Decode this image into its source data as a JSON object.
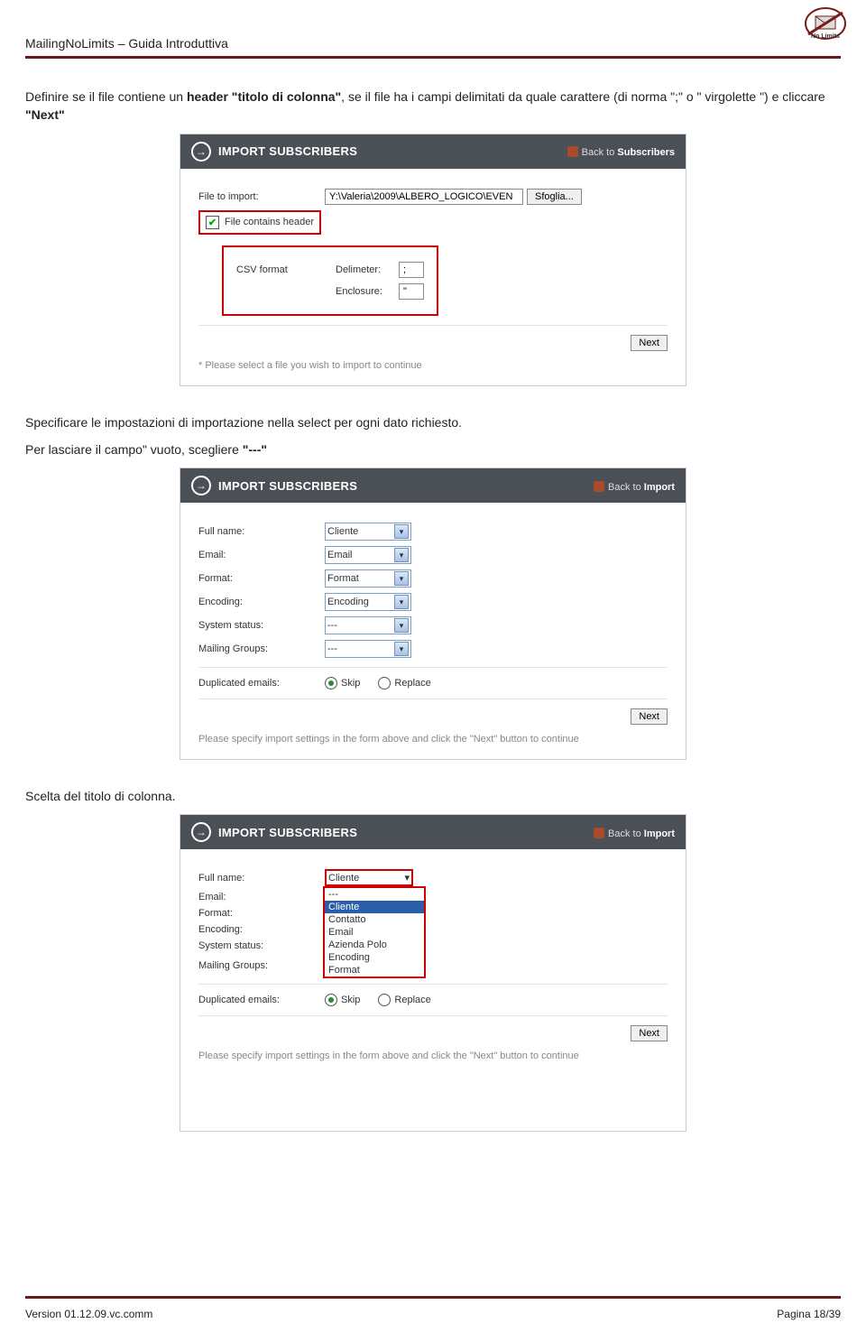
{
  "doc": {
    "header_title": "MailingNoLimits – Guida Introduttiva",
    "footer_version": "Version 01.12.09.vc.comm",
    "footer_page": "Pagina 18/39"
  },
  "intro": {
    "p1_a": "Definire se il file contiene un ",
    "p1_b": "header \"titolo di colonna\"",
    "p1_c": ", se il file ha i campi delimitati da quale carattere (di norma \";\" o \" virgolette \") e cliccare ",
    "p1_d": "\"Next\""
  },
  "panel1": {
    "title": "IMPORT SUBSCRIBERS",
    "back_prefix": "Back to ",
    "back_target": "Subscribers",
    "file_label": "File to import:",
    "file_value": "Y:\\Valeria\\2009\\ALBERO_LOGICO\\EVEN",
    "browse": "Sfoglia...",
    "header_check": "File contains header",
    "csv_label": "CSV format",
    "delim_label": "Delimeter:",
    "delim_value": ";",
    "encl_label": "Enclosure:",
    "encl_value": "\"",
    "next": "Next",
    "hint": "* Please select a file you wish to import to continue"
  },
  "mid": {
    "line1": "Specificare le impostazioni di importazione nella select per ogni dato richiesto.",
    "line2_a": "Per lasciare il campo\" vuoto, scegliere ",
    "line2_b": "\"---\""
  },
  "panel2": {
    "title": "IMPORT SUBSCRIBERS",
    "back_prefix": "Back to ",
    "back_target": "Import",
    "labels": {
      "fullname": "Full name:",
      "email": "Email:",
      "format": "Format:",
      "encoding": "Encoding:",
      "status": "System status:",
      "groups": "Mailing Groups:",
      "dup": "Duplicated emails:"
    },
    "values": {
      "fullname": "Cliente",
      "email": "Email",
      "format": "Format",
      "encoding": "Encoding",
      "status": "---",
      "groups": "---"
    },
    "skip": "Skip",
    "replace": "Replace",
    "next": "Next",
    "hint": "Please specify import settings in the form above and click the \"Next\" button to continue"
  },
  "mid2": {
    "line": "Scelta del titolo di colonna."
  },
  "panel3": {
    "title": "IMPORT SUBSCRIBERS",
    "back_prefix": "Back to ",
    "back_target": "Import",
    "labels": {
      "fullname": "Full name:",
      "email": "Email:",
      "format": "Format:",
      "encoding": "Encoding:",
      "status": "System status:",
      "groups": "Mailing Groups:",
      "dup": "Duplicated emails:"
    },
    "dd_selected": "Cliente",
    "dd_options": [
      "---",
      "Cliente",
      "Contatto",
      "Email",
      "Azienda Polo",
      "Encoding",
      "Format"
    ],
    "groups_value": "---",
    "skip": "Skip",
    "replace": "Replace",
    "next": "Next",
    "hint": "Please specify import settings in the form above and click the \"Next\" button to continue"
  }
}
